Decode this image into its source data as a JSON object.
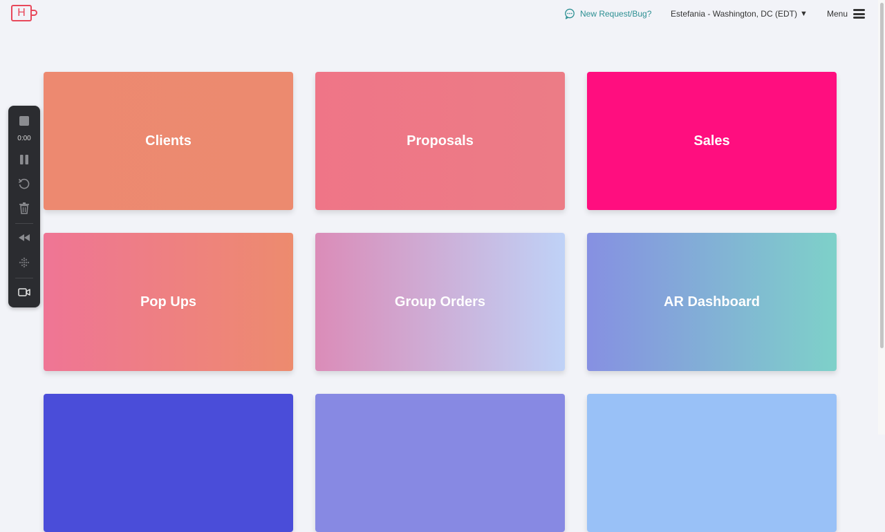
{
  "header": {
    "logo_letter": "H",
    "new_request_label": "New Request/Bug?",
    "user_location": "Estefania - Washington, DC (EDT)",
    "caret": "▼",
    "menu_label": "Menu"
  },
  "tiles": [
    {
      "label": "Clients"
    },
    {
      "label": "Proposals"
    },
    {
      "label": "Sales"
    },
    {
      "label": "Pop Ups"
    },
    {
      "label": "Group Orders"
    },
    {
      "label": "AR Dashboard"
    },
    {
      "label": ""
    },
    {
      "label": ""
    },
    {
      "label": ""
    }
  ],
  "recorder": {
    "time": "0:00",
    "icons": [
      "stop-icon",
      "pause-icon",
      "restart-icon",
      "trash-icon",
      "rewind-icon",
      "grid-icon",
      "camera-icon"
    ]
  },
  "colors": {
    "brand": "#e8475a",
    "link": "#2b8f92",
    "clients": "#ed8970",
    "proposals": "#ef7587",
    "sales": "#ff0e7f",
    "popups_from": "#ef7595",
    "popups_to": "#ed8b6e",
    "group_from": "#db8cb8",
    "group_to": "#bfd2f7",
    "ar_from": "#8690e2",
    "ar_to": "#7ed1c9",
    "row3_a": "#4a4dd9",
    "row3_b": "#8789e3",
    "row3_c": "#99c1f7"
  }
}
